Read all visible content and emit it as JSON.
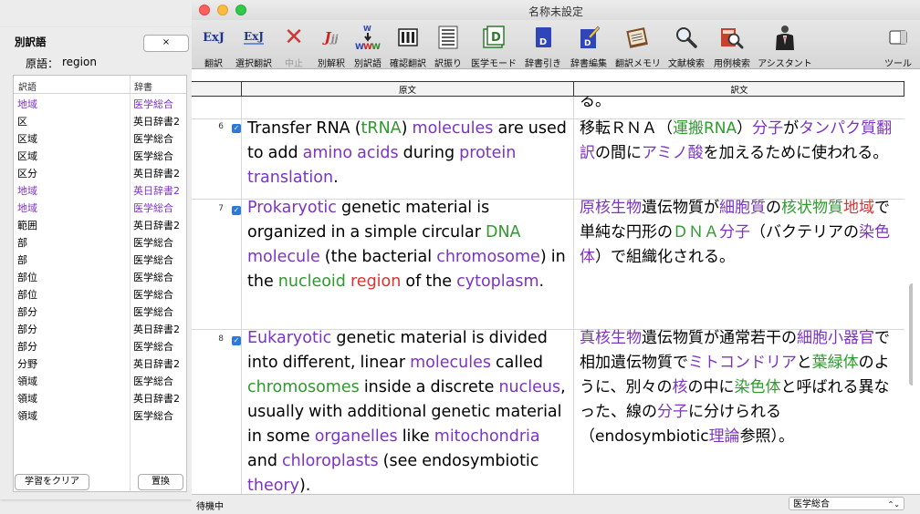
{
  "left_panel": {
    "title": "別訳語",
    "close_label": "×",
    "query_label": "原語：",
    "query_value": "region",
    "columns": {
      "translation": "訳語",
      "dictionary": "辞書"
    },
    "rows": [
      {
        "term": "地域",
        "dict": "医学総合",
        "highlight": true
      },
      {
        "term": "区",
        "dict": "英日辞書2",
        "highlight": false
      },
      {
        "term": "区域",
        "dict": "医学総合",
        "highlight": false
      },
      {
        "term": "区域",
        "dict": "医学総合",
        "highlight": false
      },
      {
        "term": "区分",
        "dict": "英日辞書2",
        "highlight": false
      },
      {
        "term": "地域",
        "dict": "英日辞書2",
        "highlight": true
      },
      {
        "term": "地域",
        "dict": "医学総合",
        "highlight": true
      },
      {
        "term": "範囲",
        "dict": "英日辞書2",
        "highlight": false
      },
      {
        "term": "部",
        "dict": "医学総合",
        "highlight": false
      },
      {
        "term": "部",
        "dict": "医学総合",
        "highlight": false
      },
      {
        "term": "部位",
        "dict": "医学総合",
        "highlight": false
      },
      {
        "term": "部位",
        "dict": "医学総合",
        "highlight": false
      },
      {
        "term": "部分",
        "dict": "医学総合",
        "highlight": false
      },
      {
        "term": "部分",
        "dict": "英日辞書2",
        "highlight": false
      },
      {
        "term": "部分",
        "dict": "医学総合",
        "highlight": false
      },
      {
        "term": "分野",
        "dict": "英日辞書2",
        "highlight": false
      },
      {
        "term": "領域",
        "dict": "医学総合",
        "highlight": false
      },
      {
        "term": "領域",
        "dict": "英日辞書2",
        "highlight": false
      },
      {
        "term": "領域",
        "dict": "医学総合",
        "highlight": false
      }
    ],
    "clear_button": "学習をクリア",
    "replace_button": "置換"
  },
  "window": {
    "title": "名称未設定"
  },
  "toolbar": {
    "items": [
      {
        "label": "翻訳",
        "icon": "exj-translate-icon",
        "glyph": "ExJ"
      },
      {
        "label": "選択翻訳",
        "icon": "exj-selection-translate-icon",
        "glyph": "ExJ"
      },
      {
        "label": "中止",
        "icon": "stop-x-icon",
        "glyph": "✕"
      },
      {
        "label": "別解釈",
        "icon": "alternate-interpretation-icon",
        "glyph": "Jj"
      },
      {
        "label": "別訳語",
        "icon": "www-alternate-terms-icon",
        "glyph": "W"
      },
      {
        "label": "確認翻訳",
        "icon": "confirm-translate-icon",
        "glyph": ""
      },
      {
        "label": "訳振り",
        "icon": "parallel-text-icon",
        "glyph": ""
      },
      {
        "label": "医学モード",
        "icon": "medical-mode-icon",
        "glyph": "D"
      },
      {
        "label": "辞書引き",
        "icon": "dictionary-lookup-icon",
        "glyph": "D"
      },
      {
        "label": "辞書編集",
        "icon": "dictionary-edit-icon",
        "glyph": "D"
      },
      {
        "label": "翻訳メモリ",
        "icon": "translation-memory-icon",
        "glyph": ""
      },
      {
        "label": "文献検索",
        "icon": "magnifier-search-icon",
        "glyph": ""
      },
      {
        "label": "用例検索",
        "icon": "example-search-icon",
        "glyph": ""
      },
      {
        "label": "アシスタント",
        "icon": "assistant-person-icon",
        "glyph": ""
      },
      {
        "label": "ツール",
        "icon": "sidebar-tools-icon",
        "glyph": ""
      }
    ]
  },
  "columns": {
    "source": "原文",
    "target": "訳文"
  },
  "segments": [
    {
      "num": "6"
    },
    {
      "num": "7"
    },
    {
      "num": "8"
    }
  ],
  "prev_fragment": "る。",
  "statusbar": {
    "status": "待機中",
    "dictionary": "医学総合",
    "dictionary_arrow": "⌃⌄"
  }
}
